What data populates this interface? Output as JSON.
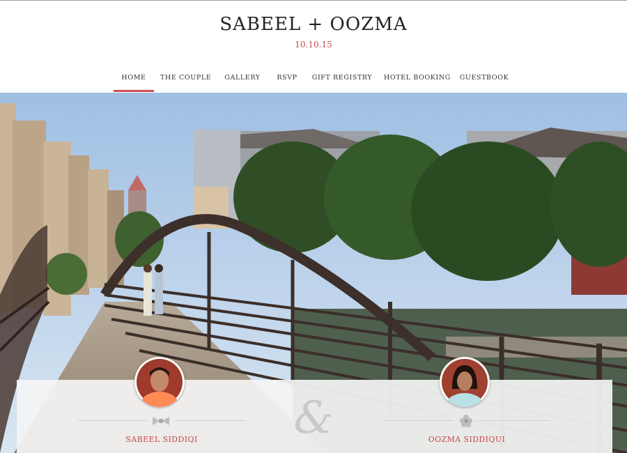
{
  "header": {
    "title": "SABEEL + OOZMA",
    "date": "10.10.15"
  },
  "nav": {
    "items": [
      {
        "label": "HOME",
        "active": true
      },
      {
        "label": "THE COUPLE"
      },
      {
        "label": "GALLERY"
      },
      {
        "label": "RSVP"
      },
      {
        "label": "GIFT REGISTRY"
      },
      {
        "label": "HOTEL BOOKING"
      },
      {
        "label": "GUESTBOOK"
      }
    ]
  },
  "couple": {
    "groom": {
      "name": "SABEEL SIDDIQI",
      "icon": "bowtie-icon"
    },
    "bride": {
      "name": "OOZMA SIDDIQUI",
      "icon": "flower-icon"
    },
    "separator": "&"
  },
  "colors": {
    "accent": "#cc4e50",
    "title_text": "#222222",
    "panel": "#f4f4f4"
  }
}
